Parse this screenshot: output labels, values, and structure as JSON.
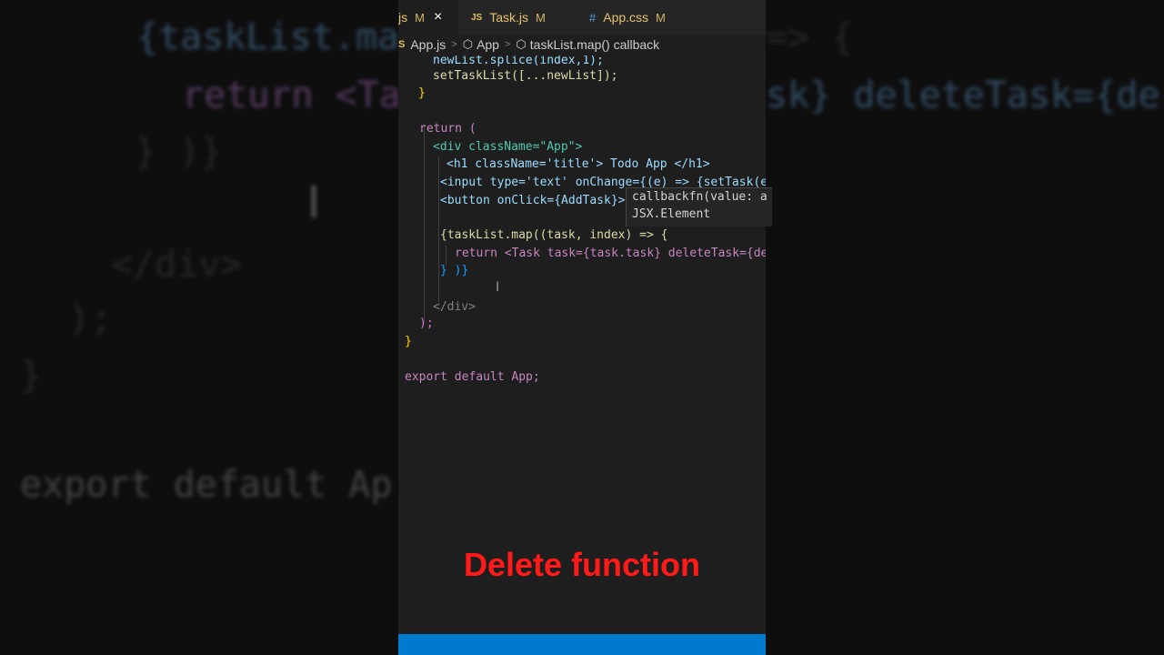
{
  "background": {
    "lines": [
      "{taskList.ma",
      "return <Ta",
      "} )}",
      "</div>",
      ");",
      "}",
      "export default Ap",
      "=> {",
      "sk} deleteTask={de"
    ]
  },
  "tabs": [
    {
      "label": "js",
      "status": "M",
      "icon": "js-file-icon",
      "close": "×",
      "active": true
    },
    {
      "label": "Task.js",
      "status": "M",
      "badge": "JS",
      "active": false
    },
    {
      "label": "App.css",
      "status": "M",
      "badge": "#",
      "active": false
    }
  ],
  "breadcrumb": {
    "file": "App.js",
    "component": "App",
    "symbol": "taskList.map() callback"
  },
  "code": {
    "lines": [
      "newList.splice(index,1);",
      "setTaskList([...newList]);",
      "}",
      "return (",
      "<div className=\"App\">",
      "<h1 className='title'> Todo App </h1>",
      "<input type='text' onChange={(e) => {setTask(e",
      "<button onClick={AddTask}>",
      "{taskList.map((task, index) => {",
      "return <Task task={task.task} deleteTask={de",
      "} )}",
      "</div>",
      ");",
      "}",
      "export default App;"
    ]
  },
  "hover_tooltip": {
    "signature": "callbackfn(value: a",
    "return_type": "JSX.Element"
  },
  "caption": "Delete function",
  "colors": {
    "caption": "#ff1a1a",
    "statusbar": "#007acc",
    "editor_bg": "#1e1e1e"
  }
}
